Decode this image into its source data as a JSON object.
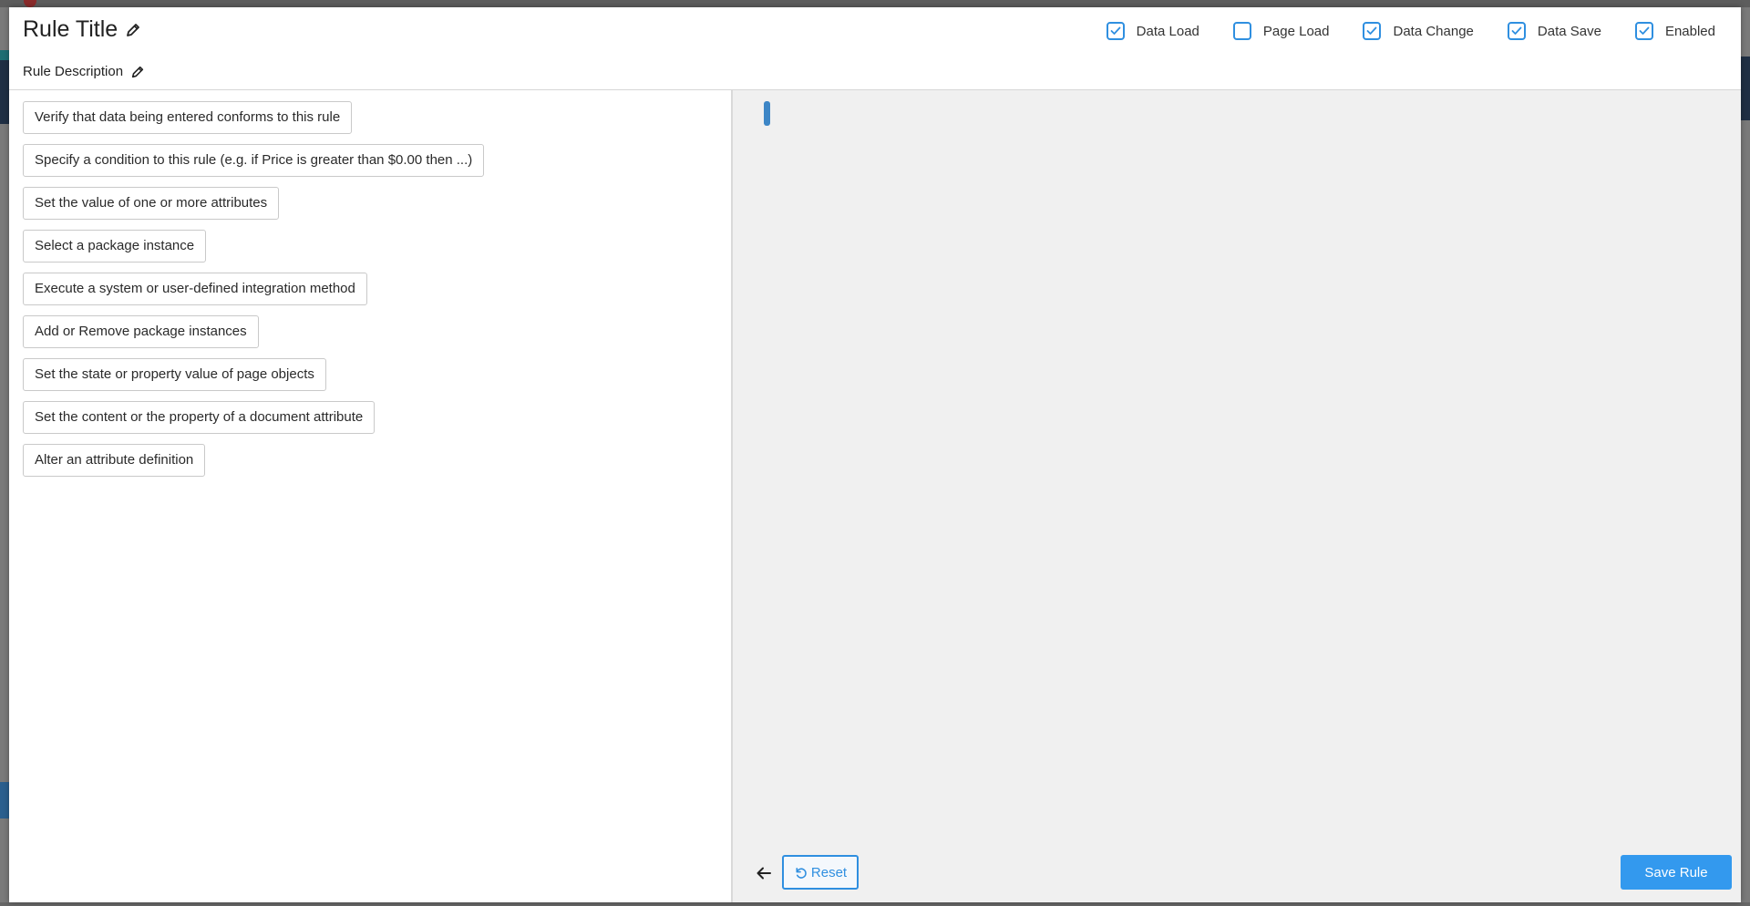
{
  "header": {
    "title": "Rule Title",
    "description": "Rule Description"
  },
  "triggers": [
    {
      "label": "Data Load",
      "checked": true
    },
    {
      "label": "Page Load",
      "checked": false
    },
    {
      "label": "Data Change",
      "checked": true
    },
    {
      "label": "Data Save",
      "checked": true
    },
    {
      "label": "Enabled",
      "checked": true
    }
  ],
  "actions": [
    "Verify that data being entered conforms to this rule",
    "Specify a condition to this rule (e.g. if Price is greater than $0.00 then ...)",
    "Set the value of one or more attributes",
    "Select a package instance",
    "Execute a system or user-defined integration method",
    "Add or Remove package instances",
    "Set the state or property value of page objects",
    "Set the content or the property of a document attribute",
    "Alter an attribute definition"
  ],
  "footer": {
    "reset_label": "Reset",
    "save_label": "Save Rule"
  },
  "colors": {
    "accent": "#2f8fe0",
    "save_button": "#3399ee",
    "editor_background": "#f0f0f0"
  }
}
